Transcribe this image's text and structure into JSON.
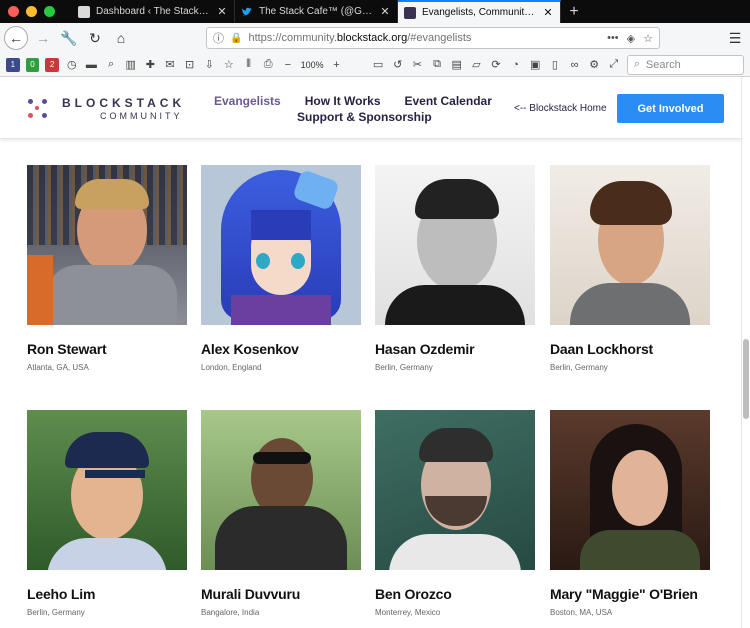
{
  "browser": {
    "tabs": [
      {
        "title": "Dashboard ‹ The Stack Cafe™",
        "active": false,
        "favicon_color": "#d9d9d9"
      },
      {
        "title": "The Stack Cafe™ (@Grid_dles)",
        "active": false,
        "favicon_color": "#1da1f2"
      },
      {
        "title": "Evangelists, Community, Amba",
        "active": true,
        "favicon_color": "#3b3150"
      }
    ],
    "url_host_prefix": "https://community.",
    "url_host_main": "blockstack.org",
    "url_path": "/#evangelists",
    "zoom": "100%",
    "search_placeholder": "Search"
  },
  "site": {
    "logo_line1": "BLOCKSTACK",
    "logo_line2": "COMMUNITY",
    "nav": {
      "evangelists": "Evangelists",
      "how_it_works": "How It Works",
      "event_calendar": "Event Calendar",
      "support": "Support & Sponsorship"
    },
    "home_link": "<-- Blockstack Home",
    "cta": "Get Involved",
    "accent_color": "#2b8cf3"
  },
  "evangelists": [
    {
      "name": "Ron Stewart",
      "location": "Atlanta, GA, USA"
    },
    {
      "name": "Alex Kosenkov",
      "location": "London, England"
    },
    {
      "name": "Hasan Ozdemir",
      "location": "Berlin, Germany"
    },
    {
      "name": "Daan Lockhorst",
      "location": "Berlin, Germany"
    },
    {
      "name": "Leeho Lim",
      "location": "Berlin, Germany"
    },
    {
      "name": "Murali Duvvuru",
      "location": "Bangalore, India"
    },
    {
      "name": "Ben Orozco",
      "location": "Monterrey, Mexico"
    },
    {
      "name": "Mary \"Maggie\" O'Brien",
      "location": "Boston, MA, USA"
    }
  ]
}
